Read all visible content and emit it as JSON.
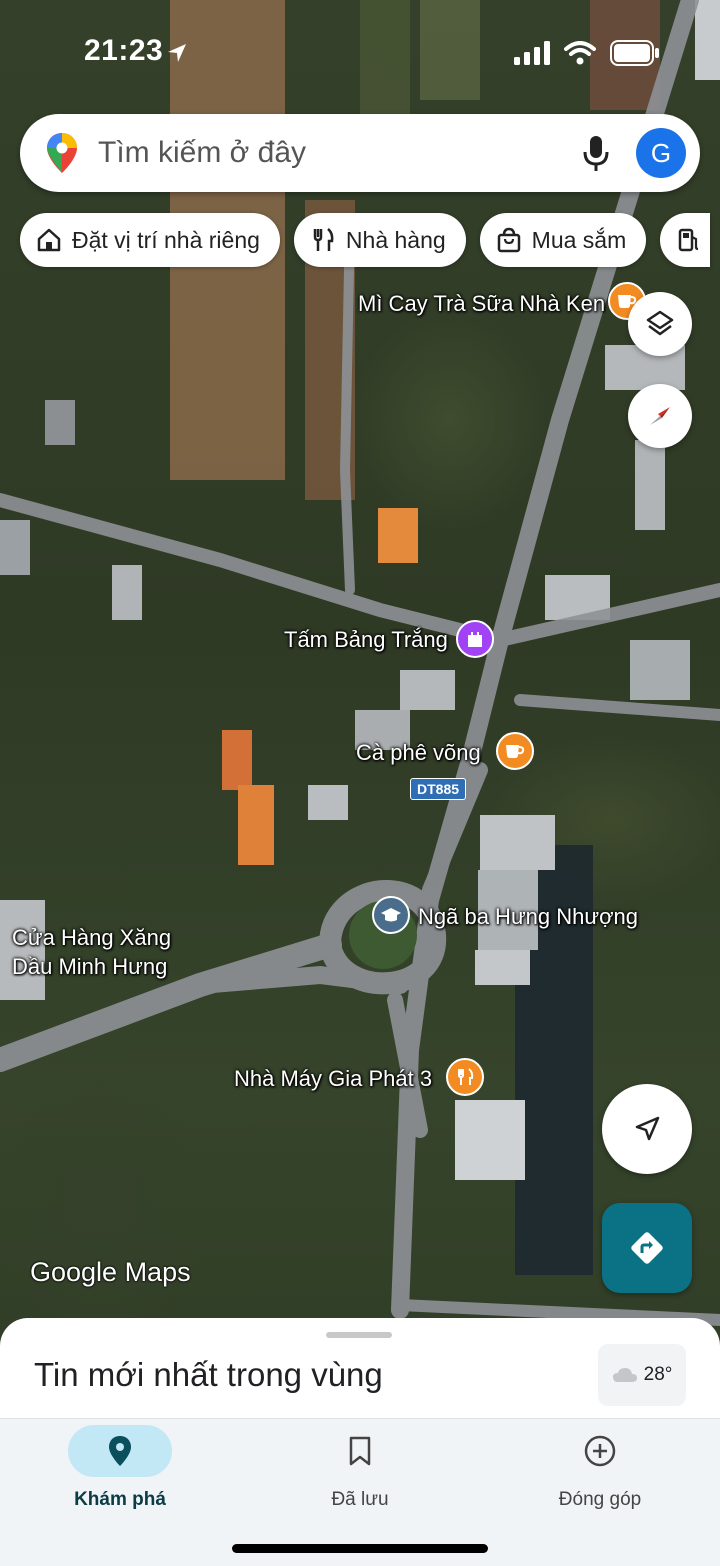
{
  "status_bar": {
    "time": "21:23"
  },
  "search": {
    "placeholder": "Tìm kiếm ở đây",
    "avatar_letter": "G"
  },
  "chips": [
    {
      "label": "Đặt vị trí nhà riêng",
      "icon": "home-icon"
    },
    {
      "label": "Nhà hàng",
      "icon": "restaurant-icon"
    },
    {
      "label": "Mua sắm",
      "icon": "shopping-bag-icon"
    },
    {
      "label": "",
      "icon": "gas-station-icon"
    }
  ],
  "map": {
    "places": {
      "mi_cay": "Mì Cay Trà Sữa Nhà Ken",
      "tam_bang": "Tấm Bảng Trắng",
      "ca_phe": "Cà phê võng",
      "nga_ba": "Ngã ba Hưng Nhượng",
      "cua_hang_line1": "Cửa Hàng Xăng",
      "cua_hang_line2": "Dầu Minh Hưng",
      "nha_may": "Nhà Máy Gia Phát 3"
    },
    "road_shield": "DT885",
    "logo": "Google Maps",
    "colors": {
      "cafe": "#f28b22",
      "landmark": "#a142f4",
      "education": "#4a6d8c",
      "restaurant": "#f28b22"
    }
  },
  "sheet": {
    "title": "Tin mới nhất trong vùng",
    "temperature": "28°"
  },
  "nav": {
    "explore": "Khám phá",
    "saved": "Đã lưu",
    "contribute": "Đóng góp"
  },
  "colors": {
    "accent": "#0b7285",
    "active_pill": "#c2e7f5",
    "avatar": "#1a73e8"
  }
}
